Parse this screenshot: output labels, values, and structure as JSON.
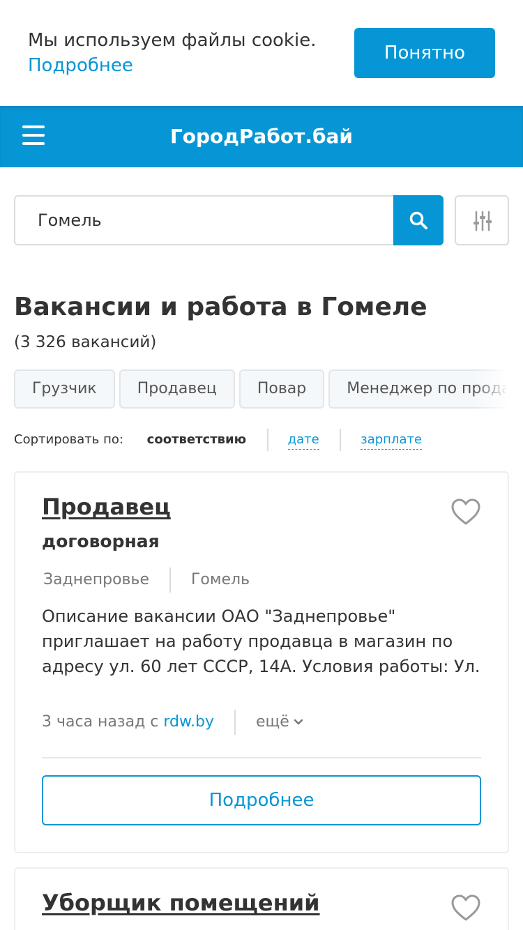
{
  "cookie": {
    "text": "Мы используем файлы cookie.",
    "link": "Подробнее",
    "button": "Понятно"
  },
  "header": {
    "logo": "ГородРабот.бай",
    "menu_icon": "burger-menu-icon"
  },
  "search": {
    "value": "Гомель",
    "search_icon": "search-icon",
    "filter_icon": "filter-sliders-icon"
  },
  "page": {
    "title": "Вакансии и работа в Гомеле",
    "count": "(3 326 вакансий)"
  },
  "tags": [
    "Грузчик",
    "Продавец",
    "Повар",
    "Менеджер по продажам"
  ],
  "sort": {
    "label": "Сортировать по:",
    "active": "соответствию",
    "options": [
      "дате",
      "зарплате"
    ]
  },
  "jobs": [
    {
      "title": "Продавец",
      "salary": "договорная",
      "company": "Заднепровье",
      "city": "Гомель",
      "description": "Описание вакансии ОАО \"Заднепровье\" приглашает на работу продавца в магазин по адресу ул. 60 лет СССР, 14А. Условия работы: Ул.",
      "time": "3 часа назад с ",
      "source": "rdw.by",
      "more": "ещё",
      "button": "Подробнее"
    },
    {
      "title": "Уборщик помещений"
    }
  ],
  "colors": {
    "accent": "#0796d5",
    "text": "#333333",
    "muted": "#777777",
    "border": "#dcdcdc"
  }
}
